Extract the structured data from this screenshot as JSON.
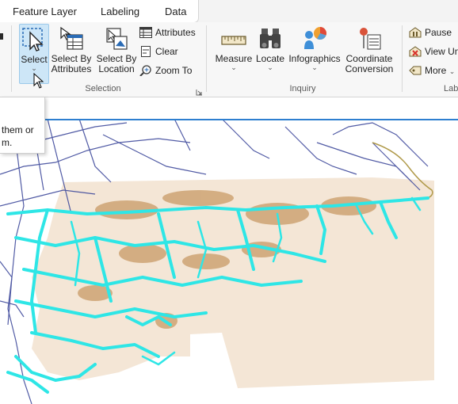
{
  "tabs": [
    {
      "label": "Feature Layer"
    },
    {
      "label": "Labeling"
    },
    {
      "label": "Data"
    }
  ],
  "ribbon": {
    "selection": {
      "group_label": "Selection",
      "select": {
        "label": "Select"
      },
      "select_by_attributes": {
        "line1": "Select By",
        "line2": "Attributes"
      },
      "select_by_location": {
        "line1": "Select By",
        "line2": "Location"
      },
      "attributes": {
        "label": "Attributes"
      },
      "clear": {
        "label": "Clear"
      },
      "zoom_to": {
        "label": "Zoom To"
      }
    },
    "inquiry": {
      "group_label": "Inquiry",
      "measure": {
        "label": "Measure"
      },
      "locate": {
        "label": "Locate"
      },
      "infographics": {
        "label": "Infographics"
      },
      "coordinate_conversion": {
        "line1": "Coordinate",
        "line2": "Conversion"
      }
    },
    "labeling": {
      "group_label": "Lab",
      "pause": {
        "label": "Pause"
      },
      "view_unplaced": {
        "label": "View Un"
      },
      "more": {
        "label": "More"
      }
    }
  },
  "tooltip": {
    "line1": "them or",
    "line2": "m."
  },
  "map": {
    "colors": {
      "roads": "#3f4a9c",
      "rivers": "#2ee6e6",
      "terrain_light": "#f4e6d6",
      "terrain_dark": "#b98a55",
      "coast": "#b09a4a"
    }
  }
}
